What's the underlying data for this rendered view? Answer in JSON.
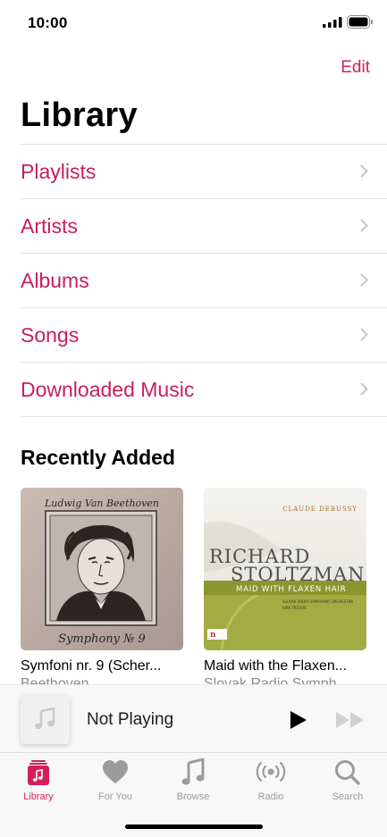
{
  "status_bar": {
    "time": "10:00"
  },
  "nav": {
    "edit_label": "Edit",
    "title": "Library"
  },
  "library": {
    "items": [
      {
        "label": "Playlists"
      },
      {
        "label": "Artists"
      },
      {
        "label": "Albums"
      },
      {
        "label": "Songs"
      },
      {
        "label": "Downloaded Music"
      }
    ]
  },
  "recently_added": {
    "title": "Recently Added",
    "albums": [
      {
        "title": "Symfoni nr. 9 (Scher...",
        "artist": "Beethoven",
        "art_header": "Ludwig Van Beethoven",
        "art_footer": "Symphony № 9"
      },
      {
        "title": "Maid with the Flaxen...",
        "artist": "Slovak Radio Symph...",
        "art_top": "CLAUDE DEBUSSY",
        "art_name_1": "RICHARD",
        "art_name_2": "STOLTZMAN",
        "art_subtitle": "MAID WITH FLAXEN HAIR",
        "art_orch_1": "SLOVAK RADIO SYMPHONY ORCHESTRA",
        "art_orch_2": "KIRK TREVOR"
      }
    ]
  },
  "mini_player": {
    "status": "Not Playing"
  },
  "tab_bar": {
    "tabs": [
      {
        "label": "Library",
        "icon": "library-icon",
        "active": true
      },
      {
        "label": "For You",
        "icon": "heart-icon",
        "active": false
      },
      {
        "label": "Browse",
        "icon": "music-note-icon",
        "active": false
      },
      {
        "label": "Radio",
        "icon": "radio-icon",
        "active": false
      },
      {
        "label": "Search",
        "icon": "search-icon",
        "active": false
      }
    ]
  },
  "colors": {
    "accent": "#d21f5a",
    "inactive": "#9b9b9b",
    "separator": "#e2e2e2"
  }
}
